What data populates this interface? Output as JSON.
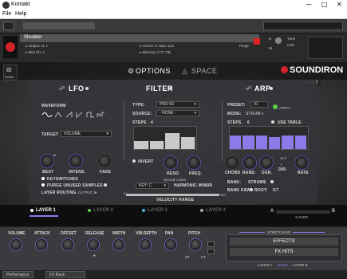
{
  "window": {
    "title": "Kontakt"
  },
  "menu": [
    "File",
    "Help"
  ],
  "instrument": {
    "name": "Shudder",
    "output": "st. 1",
    "midi": "A",
    "voices": "0",
    "voices_max": "512",
    "memory": "0.77 GB",
    "purge": "Purge",
    "tune_label": "Tune",
    "tune_value": "0.00",
    "s_label": "S",
    "m_label": "M"
  },
  "topnav": {
    "rand": "RAND",
    "options": "OPTIONS",
    "space": "SPACE",
    "brand": "SOUNDIRON",
    "layer_badge": "LAYER 1"
  },
  "lfo": {
    "title": "LFO",
    "waveform": "WAVEFORM",
    "target_label": "TARGET",
    "target_value": "VOLUME",
    "knobs": [
      "BEAT",
      "INTENS.",
      "FADE"
    ],
    "keyswitches": "KEYSWITCHES",
    "purge": "PURGE UNUSED SAMPLES",
    "routing_label": "LAYER ROUTING",
    "routing_value": "OUTPUT 1"
  },
  "filter": {
    "title": "FILTER",
    "type_label": "TYPE:",
    "type_value": "PRO 53",
    "source_label": "SOURCE:",
    "source_value": "- NONE -",
    "steps_label": "STEPS",
    "steps_value": "4",
    "steps_levels": [
      0.35,
      0.35,
      0.72,
      0.52
    ],
    "invert": "INVERT",
    "knobs": [
      "RESO.",
      "FREQ."
    ],
    "scale_lock": "SCALE LOCK",
    "key_value": "KEY: C",
    "harmonic_value": "HARMONIC MINOR",
    "velocity": "VELOCITY RANGE",
    "vel_min": "1",
    "vel_max": "127"
  },
  "arp": {
    "title": "ARP",
    "preset_label": "PRESET:",
    "preset_value": "01",
    "apply": "APPLY",
    "mode_label": "MODE:",
    "mode_value": "STRUM",
    "steps_label": "STEPS",
    "steps_value": "6",
    "use_table": "USE TABLE",
    "steps_levels": [
      0.62,
      0.62,
      0.62,
      0.55,
      0.62,
      0.62
    ],
    "knobs": [
      "CHORD",
      "RAND.",
      "DUR.",
      "DIR.",
      "RATE"
    ],
    "alt": "ALT",
    "bank_label": "BANK:",
    "bank_value": "STRUMS",
    "bank_ksw": "BANK KSW",
    "root": "ROOT:",
    "root_value": "G7"
  },
  "layers": {
    "tabs": [
      "LAYER 1",
      "LAYER 2",
      "LAYER 3",
      "LAYER 4"
    ],
    "xfade_a": "A",
    "xfade_b": "B",
    "xfade_label": "X-FADE"
  },
  "bottom": {
    "labels": [
      "VOLUME",
      "ATTACK",
      "OFFSET",
      "RELEASE",
      "WIDTH",
      "VIB.DEPTH",
      "PAN",
      "PITCH"
    ],
    "st_label": "ST",
    "ct_label": "CT",
    "stretching": "STRETCHING",
    "effects": "EFFECTS",
    "fx_hits": "FX HITS",
    "fx_layers": [
      "LAYER A",
      "NONE",
      "LAYER B"
    ]
  },
  "tabs": [
    "Performance",
    "FX Rack"
  ]
}
